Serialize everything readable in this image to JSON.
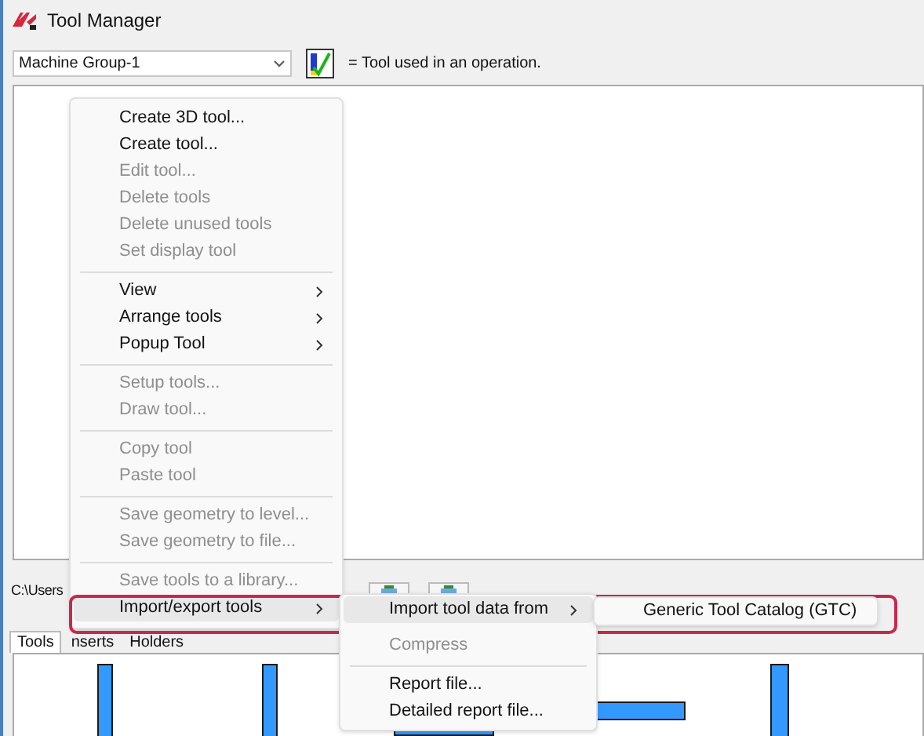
{
  "window": {
    "title": "Tool Manager"
  },
  "machine_group": {
    "value": "Machine Group-1"
  },
  "legend": "= Tool used in an operation.",
  "path": "C:\\Users",
  "tabs": [
    {
      "label": "Tools",
      "selected": true
    },
    {
      "label": "nserts",
      "selected": false
    },
    {
      "label": "Holders",
      "selected": false
    }
  ],
  "context_menu": [
    {
      "kind": "item",
      "label": "Create 3D tool...",
      "disabled": false
    },
    {
      "kind": "item",
      "label": "Create tool...",
      "disabled": false
    },
    {
      "kind": "item",
      "label": "Edit tool...",
      "disabled": true
    },
    {
      "kind": "item",
      "label": "Delete tools",
      "disabled": true
    },
    {
      "kind": "item",
      "label": "Delete unused tools",
      "disabled": true
    },
    {
      "kind": "item",
      "label": "Set display tool",
      "disabled": true
    },
    {
      "kind": "separator"
    },
    {
      "kind": "submenu",
      "label": "View",
      "disabled": false
    },
    {
      "kind": "submenu",
      "label": "Arrange tools",
      "disabled": false
    },
    {
      "kind": "submenu",
      "label": "Popup Tool",
      "disabled": false
    },
    {
      "kind": "separator"
    },
    {
      "kind": "item",
      "label": "Setup tools...",
      "disabled": true
    },
    {
      "kind": "item",
      "label": "Draw tool...",
      "disabled": true
    },
    {
      "kind": "separator"
    },
    {
      "kind": "item",
      "label": "Copy tool",
      "disabled": true
    },
    {
      "kind": "item",
      "label": "Paste tool",
      "disabled": true
    },
    {
      "kind": "separator"
    },
    {
      "kind": "item",
      "label": "Save geometry to level...",
      "disabled": true
    },
    {
      "kind": "item",
      "label": "Save geometry to file...",
      "disabled": true
    },
    {
      "kind": "separator"
    },
    {
      "kind": "item",
      "label": "Save tools to a library...",
      "disabled": true
    },
    {
      "kind": "submenu",
      "label": "Import/export tools",
      "disabled": false,
      "selected": true
    }
  ],
  "submenu": [
    {
      "kind": "submenu",
      "label": "Import tool data from",
      "disabled": false,
      "selected": true
    },
    {
      "kind": "item",
      "label": "Compress",
      "disabled": true
    },
    {
      "kind": "separator"
    },
    {
      "kind": "item",
      "label": "Report file...",
      "disabled": false
    },
    {
      "kind": "item",
      "label": "Detailed report file...",
      "disabled": false
    }
  ],
  "sub_submenu": [
    {
      "kind": "item",
      "label": "Generic Tool Catalog (GTC)",
      "disabled": false
    }
  ]
}
